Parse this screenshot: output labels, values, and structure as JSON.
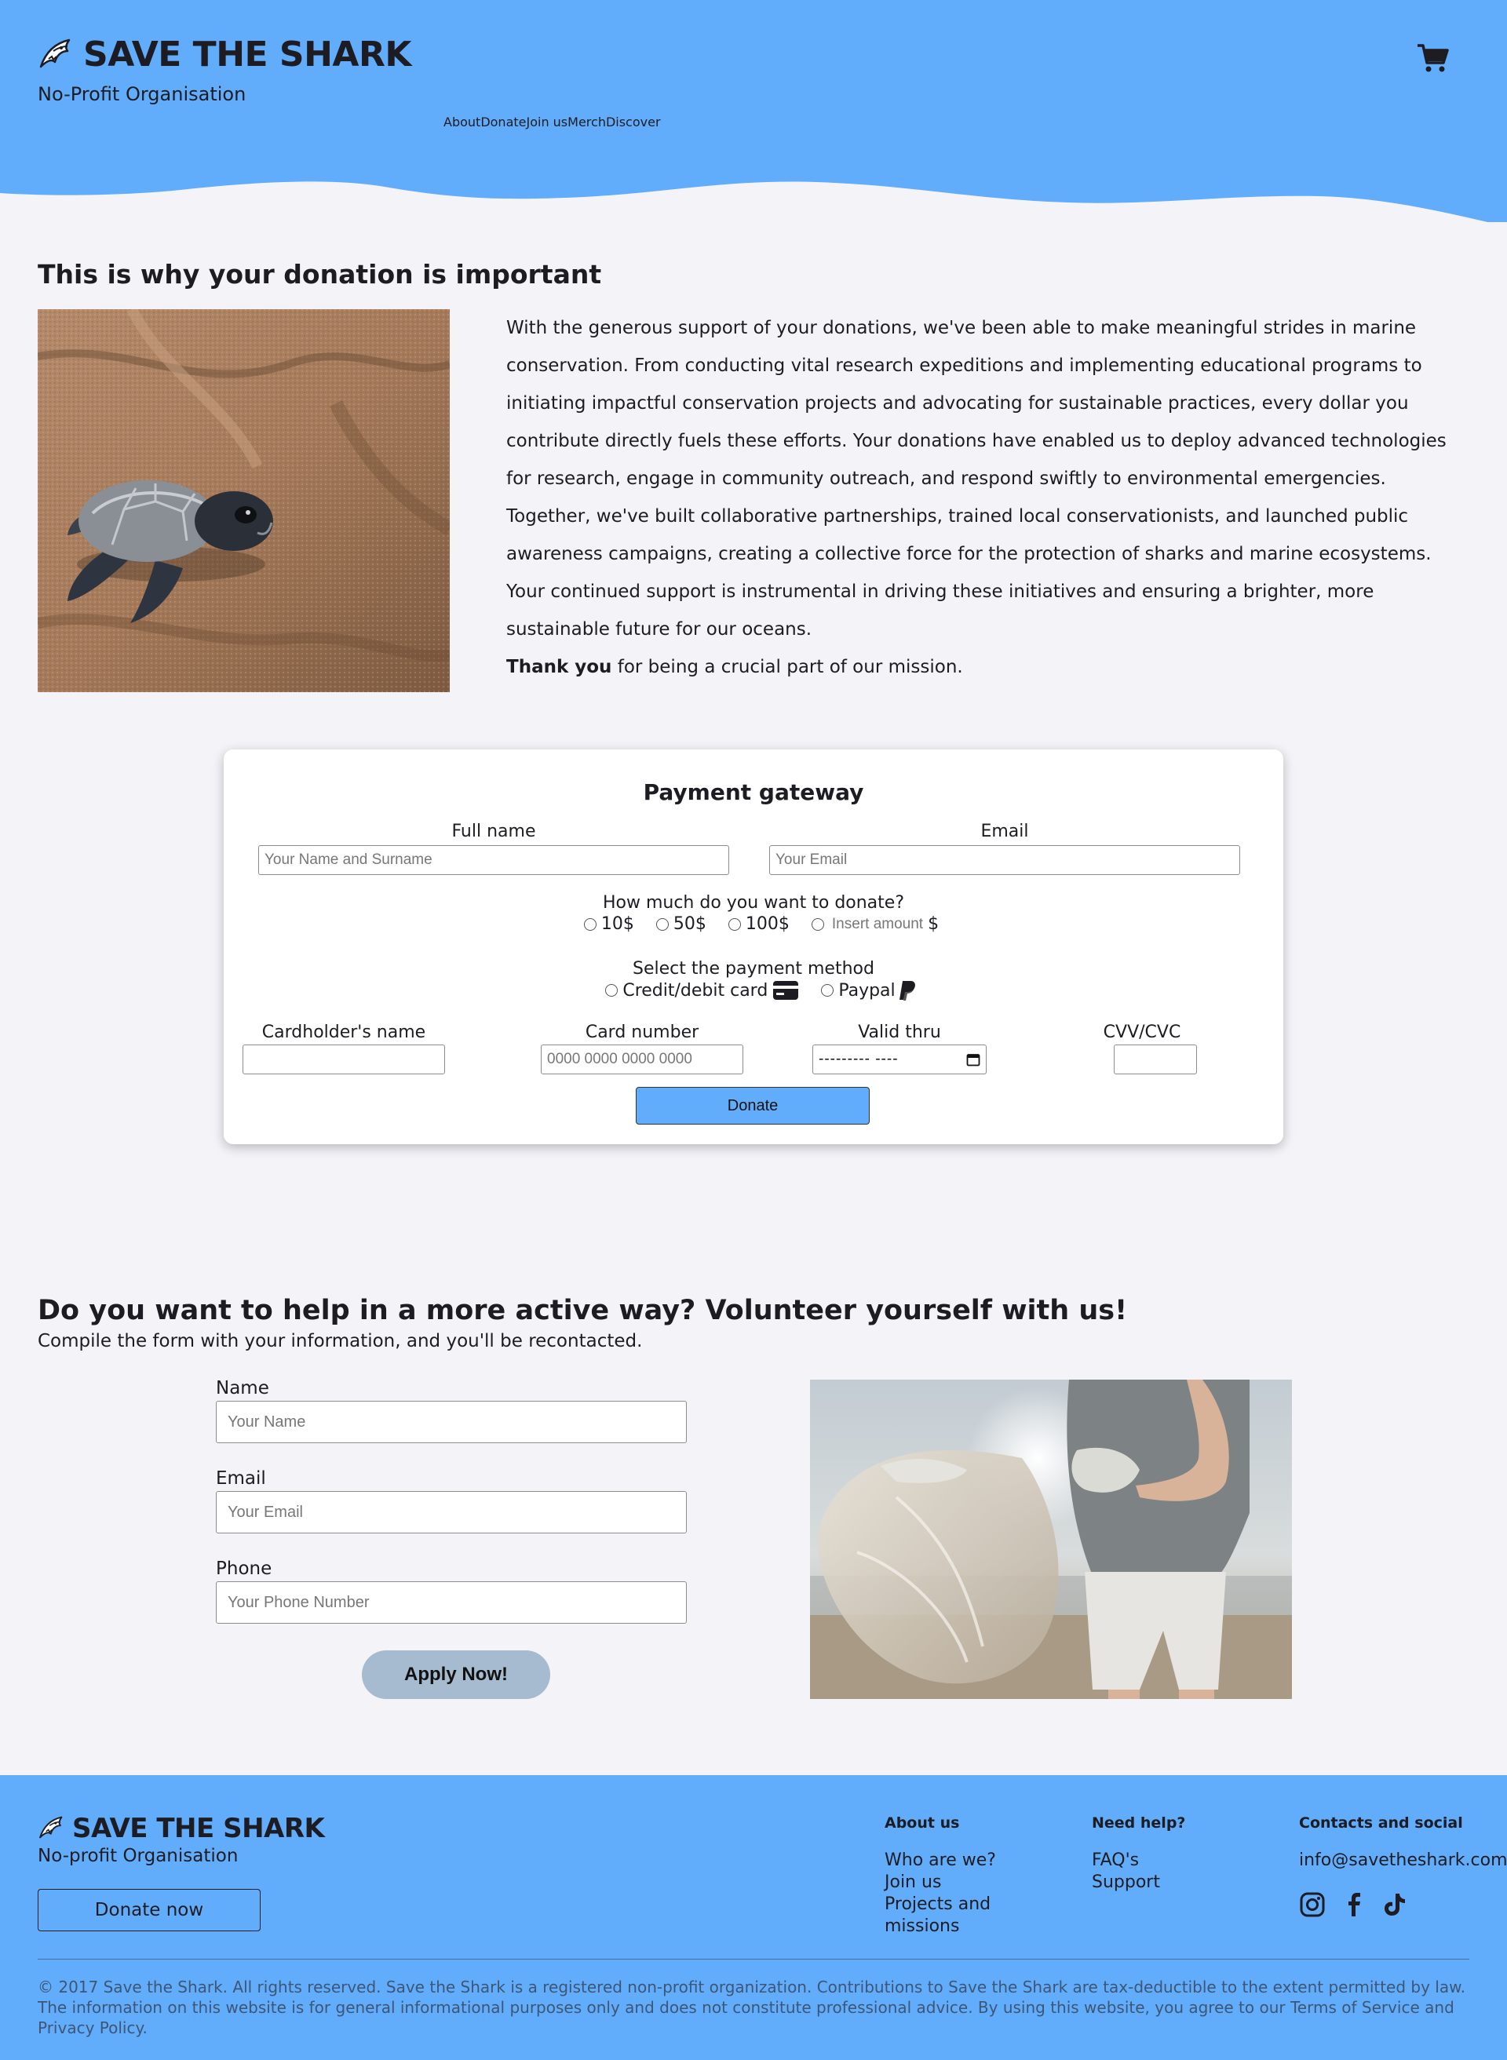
{
  "brand": {
    "name": "SAVE THE SHARK",
    "tagline": "No-Profit Organisation",
    "primary_color": "#62adfb",
    "background_color": "#f4f3f8",
    "text_color": "#1c1c22"
  },
  "header": {
    "cart_icon": "shopping-cart-icon",
    "nav": [
      {
        "label": "About"
      },
      {
        "label": "Donate"
      },
      {
        "label": "Join us"
      },
      {
        "label": "Merch"
      },
      {
        "label": "Discover"
      }
    ]
  },
  "importance": {
    "title": "This is why your donation is important",
    "image": "baby-turtle-on-sand",
    "body": "With the generous support of your donations, we've been able to make meaningful strides in marine conservation. From conducting vital research expeditions and implementing educational programs to initiating impactful conservation projects and advocating for sustainable practices, every dollar you contribute directly fuels these efforts. Your donations have enabled us to deploy advanced technologies for research, engage in community outreach, and respond swiftly to environmental emergencies. Together, we've built collaborative partnerships, trained local conservationists, and launched public awareness campaigns, creating a collective force for the protection of sharks and marine ecosystems. Your continued support is instrumental in driving these initiatives and ensuring a brighter, more sustainable future for our oceans.",
    "thanks_bold": "Thank you",
    "thanks_rest": " for being a crucial part of our mission."
  },
  "payment": {
    "title": "Payment gateway",
    "full_name_label": "Full name",
    "full_name_placeholder": "Your Name and Surname",
    "email_label": "Email",
    "email_placeholder": "Your Email",
    "amount_question": "How much do you want to donate?",
    "amounts": [
      "10$",
      "50$",
      "100$"
    ],
    "custom_amount_placeholder": "Insert amount",
    "currency": "$",
    "method_question": "Select the payment method",
    "methods": [
      {
        "label": "Credit/debit card",
        "icon": "credit-card-icon"
      },
      {
        "label": "Paypal",
        "icon": "paypal-icon"
      }
    ],
    "cardholder_label": "Cardholder's name",
    "card_number_label": "Card number",
    "card_number_placeholder": "0000 0000 0000 0000",
    "valid_thru_label": "Valid thru",
    "valid_thru_value": "--------- ----",
    "cvv_label": "CVV/CVC",
    "donate_button": "Donate"
  },
  "volunteer": {
    "title": "Do you want to help in a more active way? Volunteer yourself with us!",
    "subtitle": "Compile the form with your information, and you'll be recontacted.",
    "name_label": "Name",
    "name_placeholder": "Your Name",
    "email_label": "Email",
    "email_placeholder": "Your Email",
    "phone_label": "Phone",
    "phone_placeholder": "Your Phone Number",
    "apply_button": "Apply Now!",
    "image": "volunteer-holding-trash-bag-on-beach"
  },
  "footer": {
    "brand": "SAVE THE SHARK",
    "tagline": "No-profit Organisation",
    "donate_button": "Donate now",
    "columns": [
      {
        "heading": "About us",
        "links": [
          "Who are we?",
          "Join us",
          "Projects and missions"
        ]
      },
      {
        "heading": "Need help?",
        "links": [
          "FAQ's",
          "Support"
        ]
      },
      {
        "heading": "Contacts and social",
        "links": [
          "info@savetheshark.com"
        ]
      }
    ],
    "social_icons": [
      "instagram-icon",
      "facebook-icon",
      "tiktok-icon"
    ],
    "legal": "© 2017 Save the Shark. All rights reserved. Save the Shark is a registered non-profit organization. Contributions to Save the Shark are tax-deductible to the extent permitted by law. The information on this website is for general informational purposes only and does not constitute professional advice. By using this website, you agree to our Terms of Service and Privacy Policy."
  }
}
